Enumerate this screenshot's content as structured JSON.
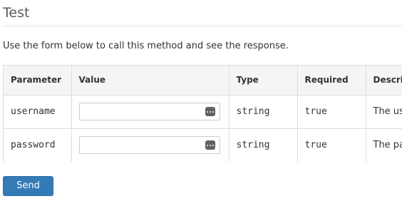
{
  "page": {
    "title": "Test",
    "intro": "Use the form below to call this method and see the response."
  },
  "table": {
    "headers": [
      "Parameter",
      "Value",
      "Type",
      "Required",
      "Description"
    ],
    "rows": [
      {
        "parameter": "username",
        "value": "",
        "type": "string",
        "required": "true",
        "description": "The username"
      },
      {
        "parameter": "password",
        "value": "",
        "type": "string",
        "required": "true",
        "description": "The password"
      }
    ]
  },
  "icons": {
    "value_field_icon": "password-manager-icon"
  },
  "form": {
    "send_label": "Send"
  },
  "colors": {
    "primary_button": "#337ab7",
    "header_background": "#f5f5f5",
    "border": "#dddddd"
  }
}
